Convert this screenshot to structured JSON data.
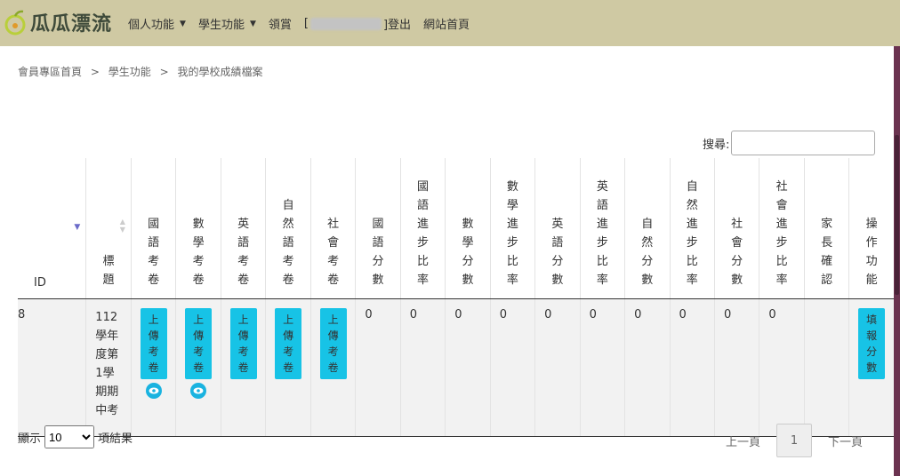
{
  "header": {
    "logo_text": "瓜瓜漂流",
    "nav": [
      {
        "label": "個人功能",
        "dropdown": true
      },
      {
        "label": "學生功能",
        "dropdown": true
      },
      {
        "label": "領賞",
        "dropdown": false
      }
    ],
    "user_open": "[",
    "logout_label": "]登出",
    "home_label": "網站首頁"
  },
  "breadcrumb": [
    "會員專區首頁",
    ">",
    "學生功能",
    ">",
    "我的學校成績檔案"
  ],
  "search": {
    "label": "搜尋:",
    "value": ""
  },
  "table": {
    "headers": [
      "ID",
      "標題",
      "國語考卷",
      "數學考卷",
      "英語考卷",
      "自然語考卷",
      "社會考卷",
      "國語分數",
      "國語進步比率",
      "數學分數",
      "數學進步比率",
      "英語分數",
      "英語進步比率",
      "自然分數",
      "自然進步比率",
      "社會分數",
      "社會進步比率",
      "家長確認",
      "操作功能"
    ],
    "row": {
      "id": "8",
      "title": "112學年度第1學期期中考",
      "upload_label": "上傳考卷",
      "scores": [
        "0",
        "0",
        "0",
        "0",
        "0",
        "0",
        "0",
        "0",
        "0",
        "0"
      ],
      "parent_confirm": "",
      "action_label": "填報分數"
    }
  },
  "footer": {
    "show_label": "顯示",
    "page_size": "10",
    "page_size_options": [
      "10"
    ],
    "results_label": "項結果",
    "prev_label": "上一頁",
    "current_page": "1",
    "next_label": "下一頁"
  },
  "colors": {
    "topbar": "#cfc9a3",
    "button": "#17c3e6",
    "frame": "#7a3b5a"
  }
}
